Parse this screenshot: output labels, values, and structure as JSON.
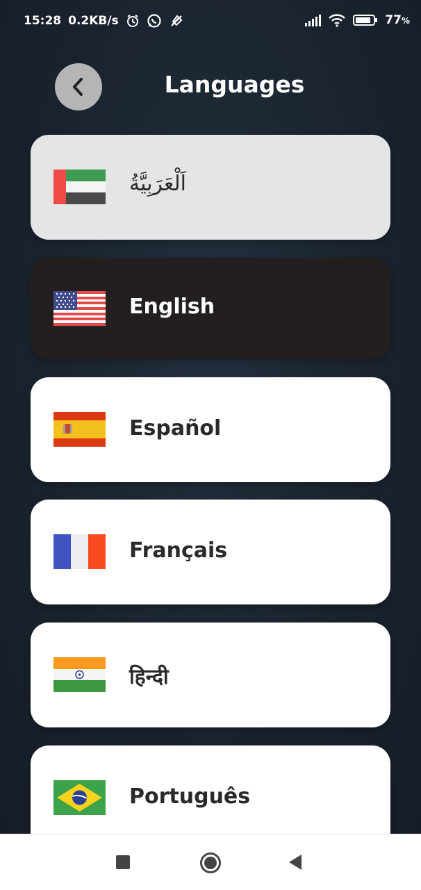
{
  "status_bar": {
    "time": "15:28",
    "speed": "0.2KB/s",
    "battery": "77"
  },
  "header": {
    "title": "Languages"
  },
  "languages": [
    {
      "label": "اَلْعَرَبِيَّةُ",
      "flag": "uae-flag-icon",
      "state": "default"
    },
    {
      "label": "English",
      "flag": "us-flag-icon",
      "state": "selected"
    },
    {
      "label": "Español",
      "flag": "spain-flag-icon",
      "state": "default"
    },
    {
      "label": "Français",
      "flag": "france-flag-icon",
      "state": "default"
    },
    {
      "label": "हिन्दी",
      "flag": "india-flag-icon",
      "state": "default"
    },
    {
      "label": "Português",
      "flag": "brazil-flag-icon",
      "state": "default"
    }
  ],
  "colors": {
    "background": "#1b2430",
    "selected_item": "#231f1f",
    "item": "#ffffff",
    "back_button": "#b5b5b5"
  }
}
